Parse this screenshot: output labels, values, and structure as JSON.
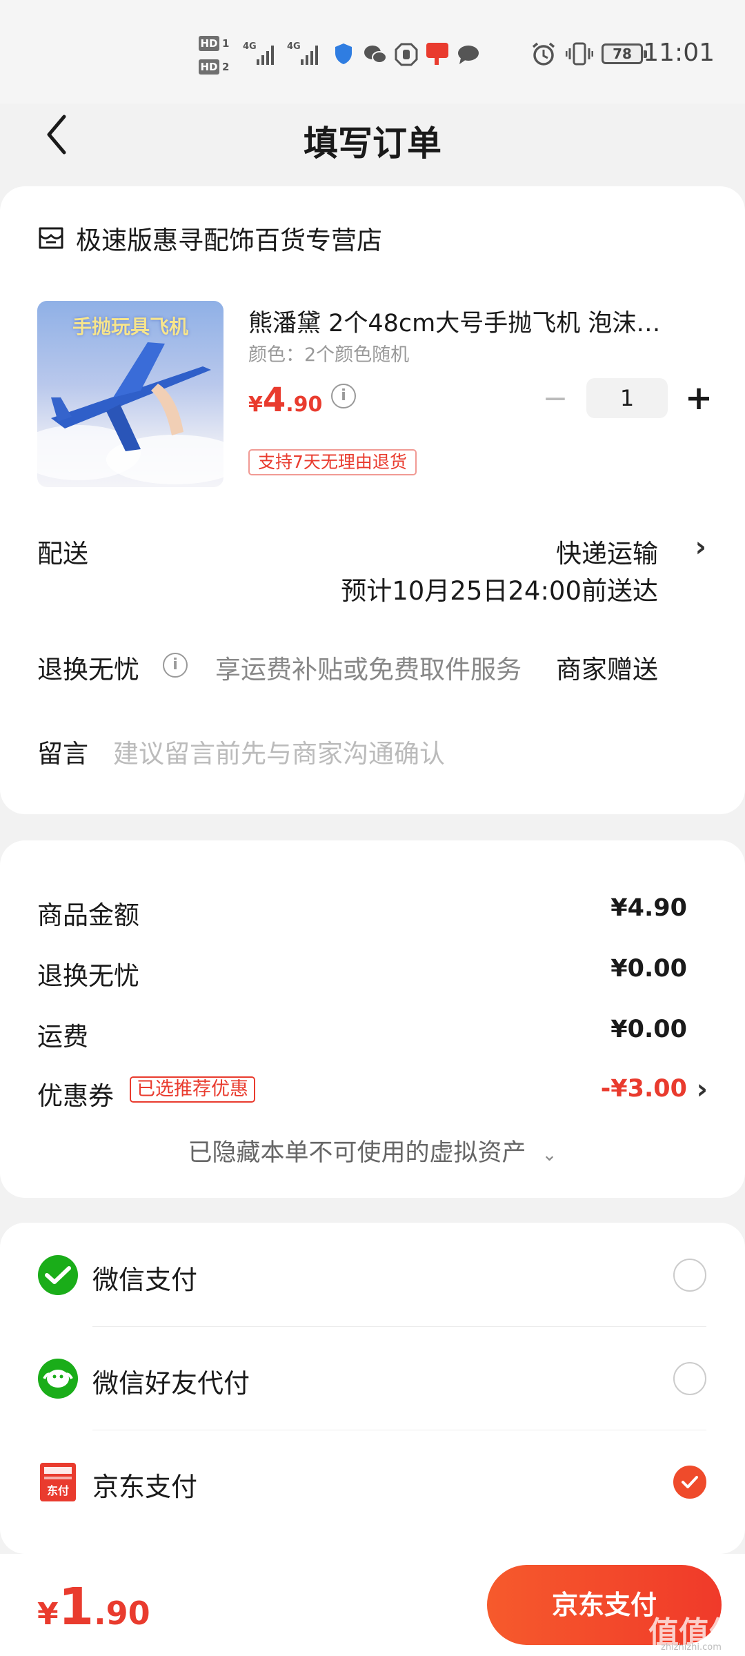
{
  "status_bar": {
    "time": "11:01",
    "battery": "78",
    "sim1": "HD",
    "sim1_num": "1",
    "sim2": "HD",
    "sim2_num": "2",
    "net1": "4G",
    "net2": "4G"
  },
  "header": {
    "title": "填写订单"
  },
  "store": {
    "name": "极速版惠寻配饰百货专营店"
  },
  "product": {
    "image_caption": "手抛玩具飞机",
    "title": "熊潘黛 2个48cm大号手抛飞机 泡沫…",
    "spec": "颜色：2个颜色随机",
    "price_symbol": "¥",
    "price_int": "4",
    "price_dec": ".90",
    "quantity": "1",
    "return_badge": "支持7天无理由退货"
  },
  "delivery": {
    "label": "配送",
    "method": "快递运输",
    "eta": "预计10月25日24:00前送达"
  },
  "exchange": {
    "label": "退换无忧",
    "desc": "享运费补贴或免费取件服务",
    "gift": "商家赠送"
  },
  "message": {
    "label": "留言",
    "placeholder": "建议留言前先与商家沟通确认"
  },
  "fees": {
    "goods_label": "商品金额",
    "goods_value": "¥4.90",
    "exchange_label": "退换无忧",
    "exchange_value": "¥0.00",
    "shipping_label": "运费",
    "shipping_value": "¥0.00",
    "coupon_label": "优惠券",
    "coupon_badge": "已选推荐优惠",
    "coupon_value": "-¥3.00",
    "hidden_assets": "已隐藏本单不可使用的虚拟资产"
  },
  "payment": {
    "options": [
      {
        "label": "微信支付",
        "selected": false,
        "icon": "wechat-pay-icon"
      },
      {
        "label": "微信好友代付",
        "selected": false,
        "icon": "wechat-friend-pay-icon"
      },
      {
        "label": "京东支付",
        "selected": true,
        "icon": "jd-pay-icon"
      }
    ]
  },
  "bottom": {
    "total_symbol": "¥",
    "total_int": "1",
    "total_dec": ".90",
    "pay_button": "京东支付"
  },
  "watermark": {
    "text": "值值值",
    "sub": "zhizhizhi.com"
  },
  "colors": {
    "accent": "#e93b2e",
    "button": "#f04a2b",
    "wechat": "#1aad19"
  }
}
